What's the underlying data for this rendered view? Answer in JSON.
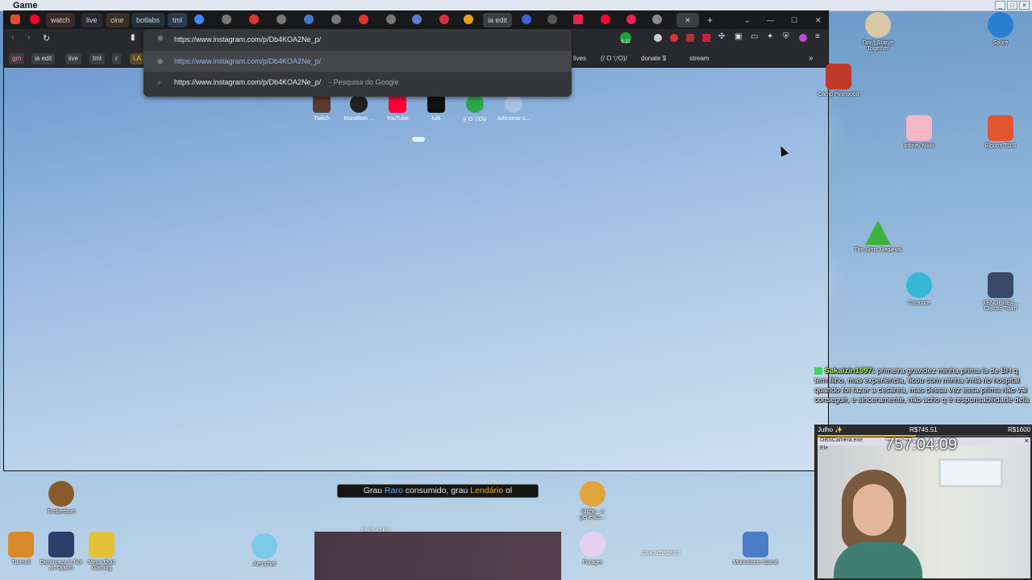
{
  "window": {
    "title": "Game"
  },
  "tabs": [
    "watch",
    "live",
    "cine",
    "botlabs",
    "tml",
    "ia edit"
  ],
  "address": {
    "value": "https://www.instagram.com/p/Db4KOA2Ne_p/"
  },
  "suggestions": [
    {
      "url": "https://www.instagram.com/p/Db4KOA2Ne_p/",
      "suffix": ""
    },
    {
      "url": "https://www.instagram.com/p/Db4KOA2Ne_p/",
      "suffix": " - Pesquisa do Google"
    }
  ],
  "toolbar": {
    "badge": "5.11"
  },
  "bookmarks": {
    "left": [
      "gm",
      "ia edit",
      "live",
      "tml",
      "r",
      "I.A."
    ],
    "right": [
      "lives",
      "(/ O ▽O)/",
      "donate $",
      "stream"
    ]
  },
  "shortcuts": [
    "Twitch",
    "Marathon ...",
    "YouTube",
    "tuiti",
    "(/ O ▽O)/",
    "Adicionar s..."
  ],
  "desktop_icons": {
    "right": [
      "Don't Starve Together",
      "Camp Pinewood",
      "Infinity Nikki",
      "Bloons TD 6",
      "The Sims Medieval",
      "Creatura",
      "XENOBREA... Classic Town",
      "Spore"
    ],
    "bottom": [
      "Timberborn",
      "Turmoil",
      "Diplomacy is Not an Option",
      "Mega Quiz Gaming",
      "Aerochat",
      "Niche - a genetics...",
      "Forager",
      "Moonstone Island"
    ]
  },
  "chat": {
    "user": "Sakaizin1997:",
    "message": "primeira gravidez minha prima la de BH q tem filho, mas experiencia, ficou com minha irmã no hospital quando foi fazer a cesárea, mas dessa vez essa prima não vai conseguir, e sinceramente, não acho q é responsabilidade dela"
  },
  "goal": {
    "label": "Julho ✨",
    "current": "R$745.51",
    "target": "R$1600"
  },
  "camera": {
    "title": "OBSCamera.exe",
    "file": "Ele",
    "timer": "757:04:09"
  },
  "toast": {
    "prefix": "Grau ",
    "rare": "Raro",
    "middle": " consumido, grau ",
    "legendary": "Lendário",
    "suffix": " ol"
  },
  "game_labels": {
    "player1": "PAPLASEA",
    "player2": "SAKAIZIN1557"
  },
  "colors": {
    "rare": "#6ea8ff",
    "legendary": "#f3b31a",
    "chat_user": "#b9f26b"
  }
}
